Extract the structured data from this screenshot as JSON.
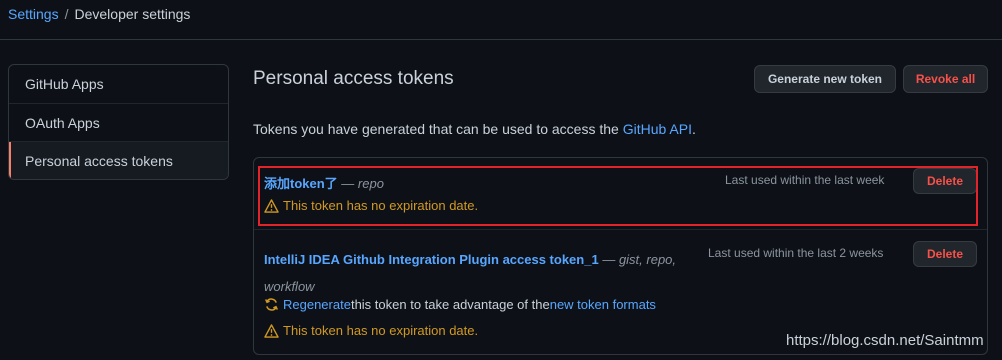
{
  "breadcrumb": {
    "settings": "Settings",
    "separator": "/",
    "current": "Developer settings"
  },
  "sidebar": {
    "items": [
      {
        "label": "GitHub Apps",
        "active": false
      },
      {
        "label": "OAuth Apps",
        "active": false
      },
      {
        "label": "Personal access tokens",
        "active": true
      }
    ]
  },
  "main": {
    "title": "Personal access tokens",
    "generate_label": "Generate new token",
    "revoke_label": "Revoke all",
    "desc_prefix": "Tokens you have generated that can be used to access the ",
    "desc_link": "GitHub API",
    "desc_suffix": "."
  },
  "tokens": [
    {
      "name": "添加token了",
      "dash": " — ",
      "scopes": "repo",
      "last_used": "Last used within the last week",
      "delete_label": "Delete",
      "warning": "This token has no expiration date."
    },
    {
      "name": "IntelliJ IDEA Github Integration Plugin access token_1",
      "dash": " — ",
      "scopes": "gist, repo,",
      "scopes_line2": "workflow",
      "last_used": "Last used within the last 2 weeks",
      "delete_label": "Delete",
      "regen_link": "Regenerate",
      "regen_middle": " this token to take advantage of the ",
      "regen_link2": "new token formats",
      "warning": "This token has no expiration date."
    }
  ],
  "watermark": "https://blog.csdn.net/Saintmm",
  "colors": {
    "background": "#0d1117",
    "link": "#58a6ff",
    "danger": "#f85149",
    "warning": "#d29922",
    "highlight": "#e0242a",
    "active_marker": "#f78166"
  },
  "icons": {
    "warning": "alert-triangle-icon",
    "regenerate": "sync-icon"
  }
}
